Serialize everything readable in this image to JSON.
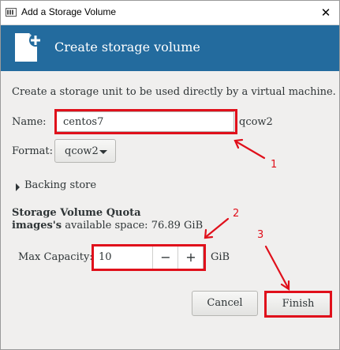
{
  "window": {
    "title": "Add a Storage Volume",
    "close_glyph": "✕"
  },
  "header": {
    "title": "Create storage volume",
    "icon": "file-add-icon"
  },
  "description": "Create a storage unit to be used directly by a virtual machine.",
  "name": {
    "label": "Name:",
    "value": "centos7",
    "suffix": "qcow2"
  },
  "format": {
    "label": "Format:",
    "selected": "qcow2"
  },
  "backing_store": {
    "label": "Backing store"
  },
  "quota": {
    "title": "Storage Volume Quota",
    "pool": "images's",
    "available_label": "available space: 76.89 GiB"
  },
  "capacity": {
    "label": "Max Capacity:",
    "value": "10",
    "minus": "−",
    "plus": "+",
    "unit": "GiB"
  },
  "buttons": {
    "cancel": "Cancel",
    "finish": "Finish"
  },
  "annotations": [
    "1",
    "2",
    "3"
  ],
  "colors": {
    "header_bg": "#236b9e",
    "annotation_red": "#e0101b"
  }
}
